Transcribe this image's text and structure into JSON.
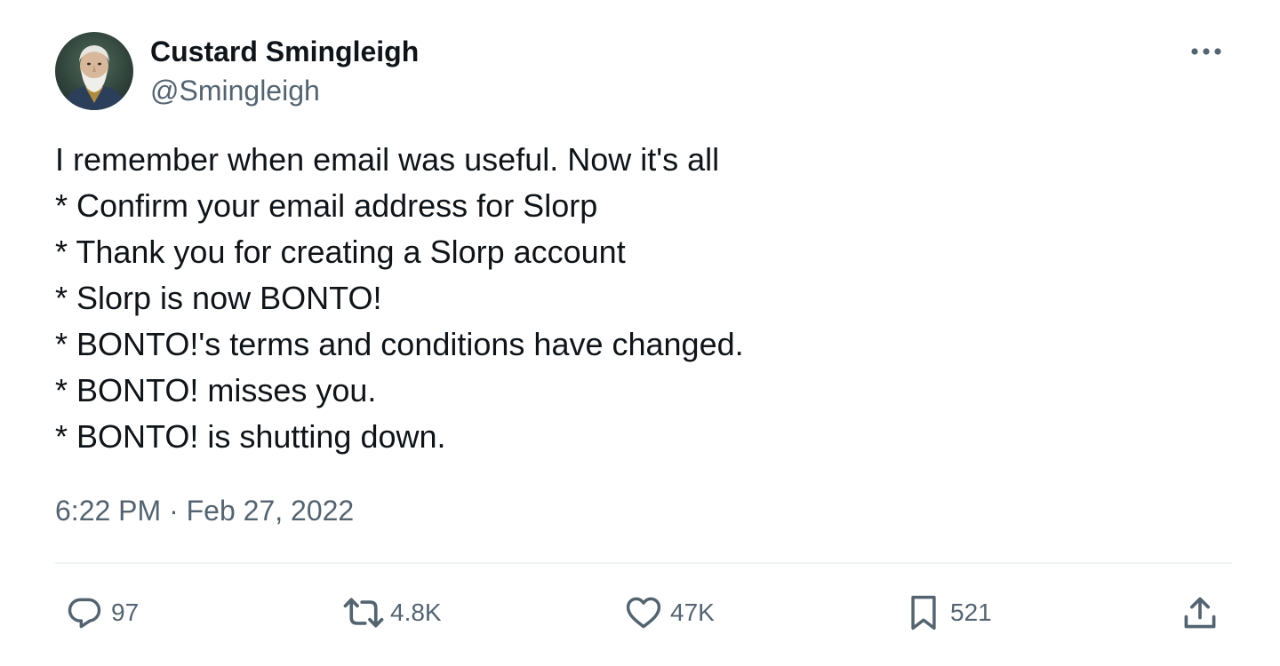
{
  "author": {
    "display_name": "Custard Smingleigh",
    "handle": "@Smingleigh",
    "avatar_icon": "avatar-portrait"
  },
  "menu": {
    "icon": "more-horizontal-icon"
  },
  "tweet": {
    "lines": [
      "I remember when email was useful. Now it's all",
      "* Confirm your email address for Slorp",
      "* Thank you for creating a Slorp account",
      "* Slorp is now BONTO!",
      "* BONTO!'s terms and conditions have changed.",
      "* BONTO! misses you.",
      "* BONTO! is shutting down."
    ],
    "time": "6:22 PM",
    "separator": "·",
    "date": "Feb 27, 2022"
  },
  "actions": {
    "replies": {
      "count": "97",
      "icon": "reply-icon"
    },
    "retweets": {
      "count": "4.8K",
      "icon": "retweet-icon"
    },
    "likes": {
      "count": "47K",
      "icon": "heart-icon"
    },
    "bookmarks": {
      "count": "521",
      "icon": "bookmark-icon"
    },
    "share": {
      "icon": "share-icon"
    }
  },
  "colors": {
    "text_primary": "#0f1419",
    "text_secondary": "#536471",
    "divider": "#eff3f4"
  }
}
